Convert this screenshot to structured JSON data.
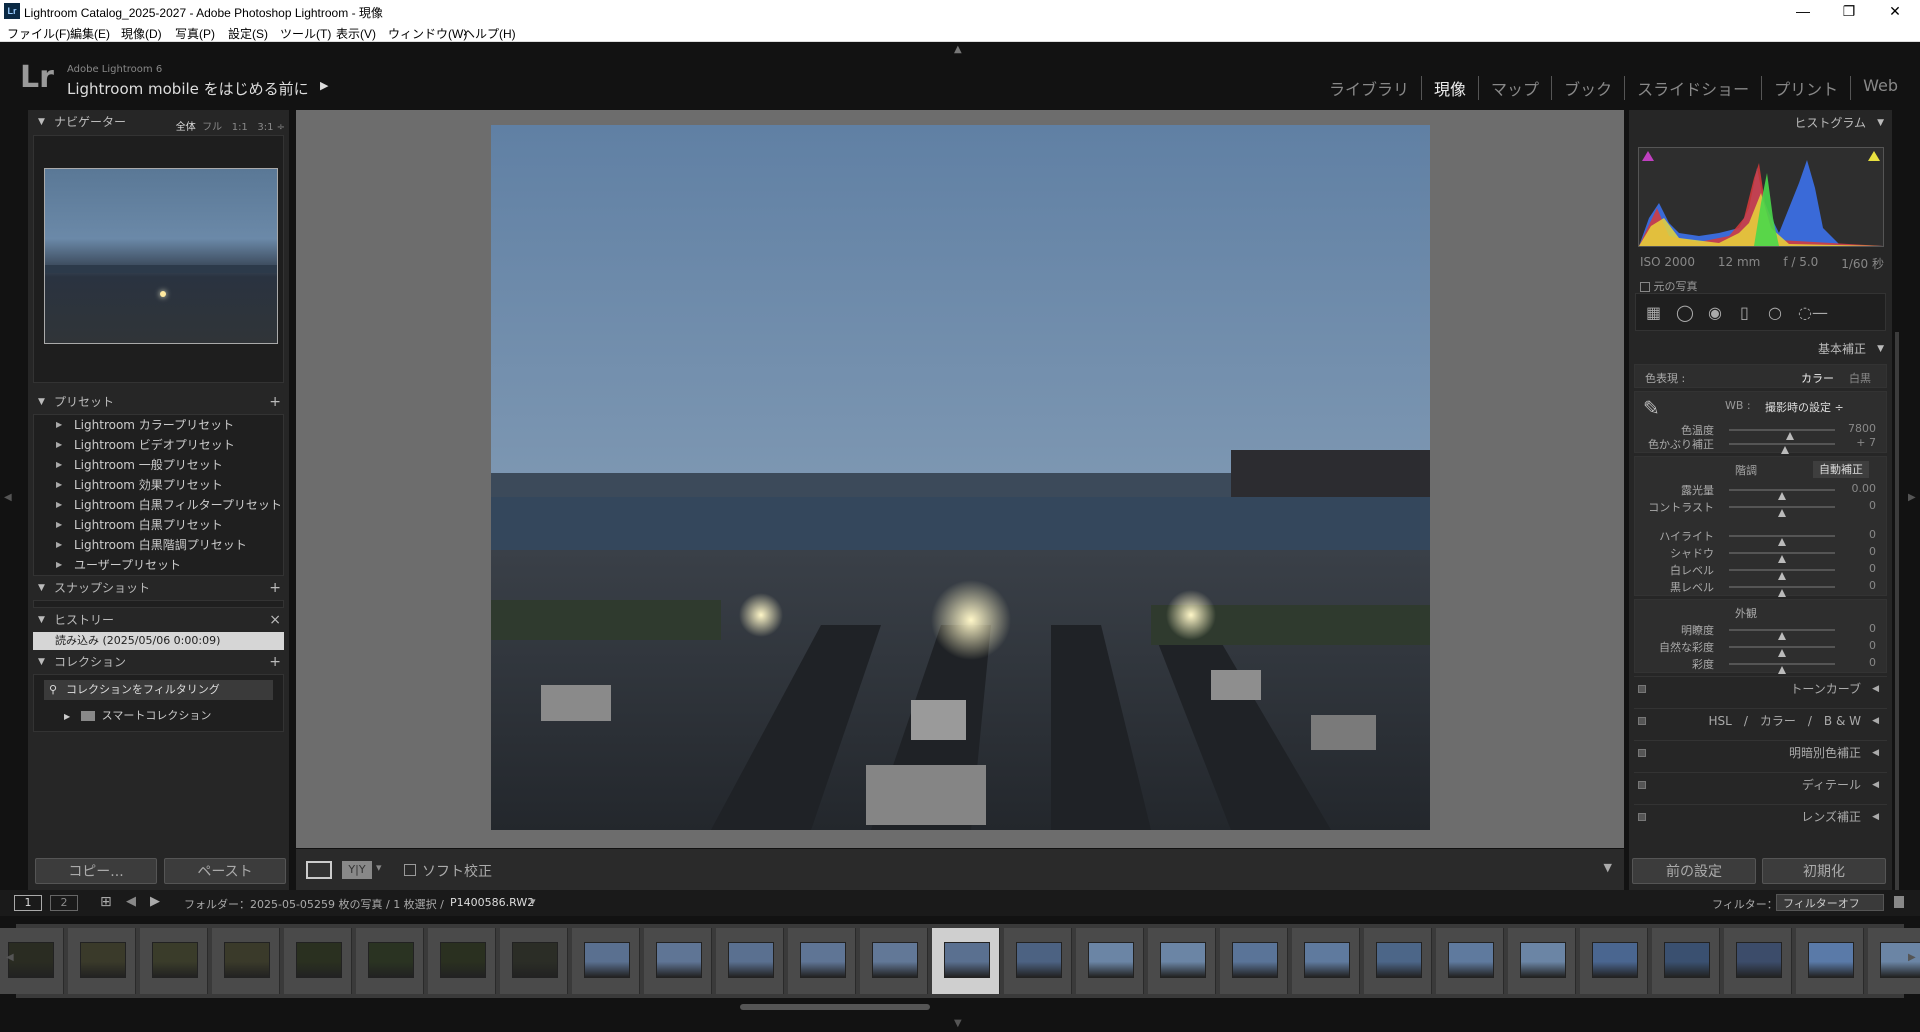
{
  "window": {
    "title": "Lightroom Catalog_2025-2027 - Adobe Photoshop Lightroom - 現像",
    "icon": "Lr"
  },
  "menu": [
    "ファイル(F)",
    "編集(E)",
    "現像(D)",
    "写真(P)",
    "設定(S)",
    "ツール(T)",
    "表示(V)",
    "ウィンドウ(W)",
    "ヘルプ(H)"
  ],
  "identity": {
    "logo": "Lr",
    "app": "Adobe Lightroom 6",
    "message": "Lightroom mobile をはじめる前に"
  },
  "modules": [
    {
      "label": "ライブラリ",
      "active": false
    },
    {
      "label": "現像",
      "active": true
    },
    {
      "label": "マップ",
      "active": false
    },
    {
      "label": "ブック",
      "active": false
    },
    {
      "label": "スライドショー",
      "active": false
    },
    {
      "label": "プリント",
      "active": false
    },
    {
      "label": "Web",
      "active": false
    }
  ],
  "left": {
    "navigator": {
      "title": "ナビゲーター",
      "opts": [
        "全体",
        "フル",
        "1:1",
        "3:1"
      ]
    },
    "presets": {
      "title": "プリセット",
      "items": [
        "Lightroom カラープリセット",
        "Lightroom ビデオプリセット",
        "Lightroom 一般プリセット",
        "Lightroom 効果プリセット",
        "Lightroom 白黒フィルタープリセット",
        "Lightroom 白黒プリセット",
        "Lightroom 白黒階調プリセット",
        "ユーザープリセット"
      ]
    },
    "snapshots": {
      "title": "スナップショット"
    },
    "history": {
      "title": "ヒストリー",
      "item": "読み込み (2025/05/06 0:00:09)"
    },
    "collections": {
      "title": "コレクション",
      "filter": "コレクションをフィルタリング",
      "smart": "スマートコレクション"
    },
    "copy": "コピー...",
    "paste": "ペースト"
  },
  "toolbar": {
    "soft_proof": "ソフト校正"
  },
  "right": {
    "histogram": {
      "title": "ヒストグラム",
      "iso": "ISO 2000",
      "focal": "12 mm",
      "aperture": "f / 5.0",
      "shutter": "1/60 秒",
      "original": "元の写真"
    },
    "basic": {
      "title": "基本補正",
      "treatment_label": "色表現 :",
      "color": "カラー",
      "bw": "白黒",
      "wb_label": "WB :",
      "wb_value": "撮影時の設定 ÷",
      "tone": "階調",
      "auto": "自動補正",
      "presence": "外観",
      "sliders": [
        {
          "label": "色温度",
          "value": "7800",
          "pos": 0.58
        },
        {
          "label": "色かぶり補正",
          "value": "+ 7",
          "pos": 0.53
        },
        {
          "label": "露光量",
          "value": "0.00",
          "pos": 0.5
        },
        {
          "label": "コントラスト",
          "value": "0",
          "pos": 0.5
        },
        {
          "label": "ハイライト",
          "value": "0",
          "pos": 0.5
        },
        {
          "label": "シャドウ",
          "value": "0",
          "pos": 0.5
        },
        {
          "label": "白レベル",
          "value": "0",
          "pos": 0.5
        },
        {
          "label": "黒レベル",
          "value": "0",
          "pos": 0.5
        },
        {
          "label": "明瞭度",
          "value": "0",
          "pos": 0.5
        },
        {
          "label": "自然な彩度",
          "value": "0",
          "pos": 0.5
        },
        {
          "label": "彩度",
          "value": "0",
          "pos": 0.5
        }
      ]
    },
    "panels": [
      "トーンカーブ",
      "HSL　/　カラー　/　B & W",
      "明暗別色補正",
      "ディテール",
      "レンズ補正"
    ],
    "prev": "前の設定",
    "reset": "初期化"
  },
  "filmstrip": {
    "page1": "1",
    "page2": "2",
    "folder": "フォルダー：2025-05-05",
    "count": "259 枚の写真 / 1 枚選択 /",
    "file": "P1400586.RW2",
    "filter_label": "フィルター：",
    "filter_value": "フィルターオフ"
  },
  "colors": {
    "accent": "#ffffff",
    "panel": "#262626",
    "center_bg": "#6d6d6d"
  }
}
